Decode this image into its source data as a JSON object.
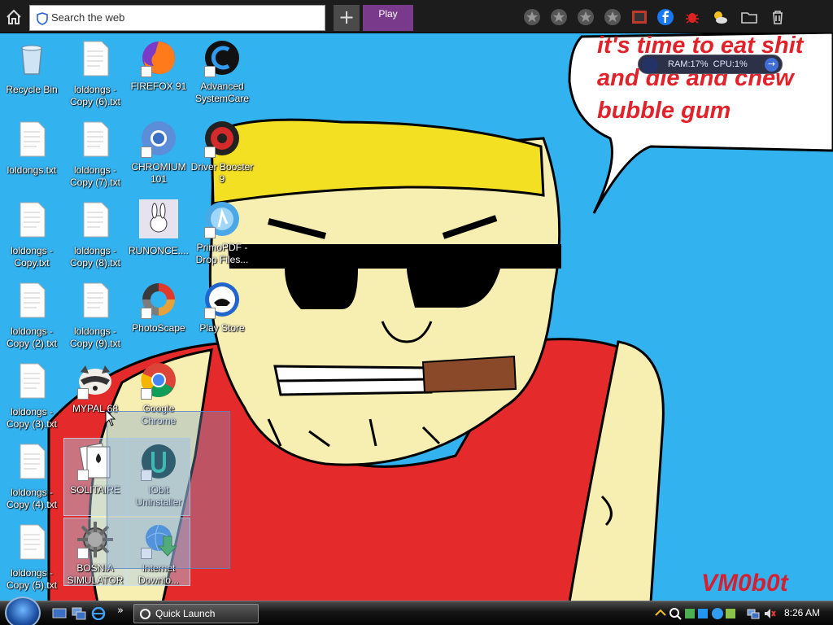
{
  "toolbar": {
    "search_placeholder": "Search the web",
    "play_label": "Play"
  },
  "desktop": {
    "icons": [
      {
        "label": "Recycle Bin"
      },
      {
        "label": "loldongs - Copy (6).txt"
      },
      {
        "label": "FIREFOX 91"
      },
      {
        "label": "Advanced SystemCare"
      },
      {
        "label": "loldongs.txt"
      },
      {
        "label": "loldongs - Copy (7).txt"
      },
      {
        "label": "CHROMIUM 101"
      },
      {
        "label": "Driver Booster 9"
      },
      {
        "label": "loldongs - Copy.txt"
      },
      {
        "label": "loldongs - Copy (8).txt"
      },
      {
        "label": "RUNONCE...."
      },
      {
        "label": "PrimoPDF - Drop Files..."
      },
      {
        "label": "loldongs - Copy (2).txt"
      },
      {
        "label": "loldongs - Copy (9).txt"
      },
      {
        "label": "PhotoScape"
      },
      {
        "label": "Play Store"
      },
      {
        "label": "loldongs - Copy (3).txt"
      },
      {
        "label": "MYPAL 68"
      },
      {
        "label": "Google Chrome"
      },
      {
        "label": "loldongs - Copy (4).txt"
      },
      {
        "label": "SOLITAIRE"
      },
      {
        "label": "IObit Uninstaller"
      },
      {
        "label": "loldongs - Copy (5).txt"
      },
      {
        "label": "BOSNIA SIMULATOR"
      },
      {
        "label": "Internet Downlo..."
      }
    ]
  },
  "wallpaper": {
    "speech_line1": "it's time to eat shit",
    "speech_line2": "and die and chew",
    "speech_line3": "bubble gum",
    "signature": "VM0b0t"
  },
  "resource_monitor": {
    "ram": "RAM:17%",
    "cpu": "CPU:1%"
  },
  "taskbar": {
    "quick_launch_label": "Quick Launch",
    "clock": "8:26 AM"
  },
  "colors": {
    "desktop_bg": "#33b2f0",
    "shirt_red": "#e42a2a",
    "skin": "#f7efb2",
    "hair": "#f4e022",
    "speech_text": "#e0222a",
    "play_button": "#7a3a8c"
  }
}
